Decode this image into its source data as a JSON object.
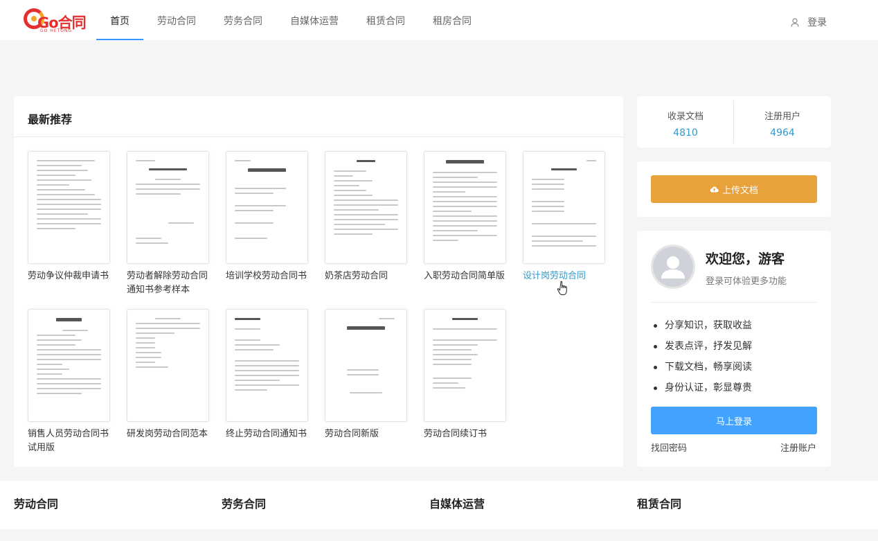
{
  "logo": {
    "text": "Go合同",
    "subtitle": "GO HETONG"
  },
  "nav": {
    "items": [
      {
        "label": "首页",
        "active": true
      },
      {
        "label": "劳动合同",
        "active": false
      },
      {
        "label": "劳务合同",
        "active": false
      },
      {
        "label": "自媒体运营",
        "active": false
      },
      {
        "label": "租赁合同",
        "active": false
      },
      {
        "label": "租房合同",
        "active": false
      }
    ],
    "login_label": "登录"
  },
  "recommend": {
    "title": "最新推荐",
    "docs": [
      {
        "title": "劳动争议仲裁申请书"
      },
      {
        "title": "劳动者解除劳动合同通知书参考样本"
      },
      {
        "title": "培训学校劳动合同书"
      },
      {
        "title": "奶茶店劳动合同"
      },
      {
        "title": "入职劳动合同简单版"
      },
      {
        "title": "设计岗劳动合同"
      },
      {
        "title": "销售人员劳动合同书试用版"
      },
      {
        "title": "研发岗劳动合同范本"
      },
      {
        "title": "终止劳动合同通知书"
      },
      {
        "title": "劳动合同新版"
      },
      {
        "title": "劳动合同续订书"
      }
    ]
  },
  "stats": {
    "docs_label": "收录文档",
    "docs_value": "4810",
    "users_label": "注册用户",
    "users_value": "4964"
  },
  "upload": {
    "label": "上传文档"
  },
  "welcome": {
    "title": "欢迎您，游客",
    "subtitle": "登录可体验更多功能",
    "benefits": [
      "分享知识，获取收益",
      "发表点评，抒发见解",
      "下载文档，畅享阅读",
      "身份认证，彰显尊贵"
    ],
    "login_label": "马上登录",
    "forgot_label": "找回密码",
    "register_label": "注册账户"
  },
  "categories": [
    "劳动合同",
    "劳务合同",
    "自媒体运营",
    "租赁合同"
  ],
  "colors": {
    "accent": "#3399ff",
    "link": "#3399cc",
    "upload": "#e8a23b",
    "login": "#42a3ff",
    "logo": "#e62e2e"
  }
}
